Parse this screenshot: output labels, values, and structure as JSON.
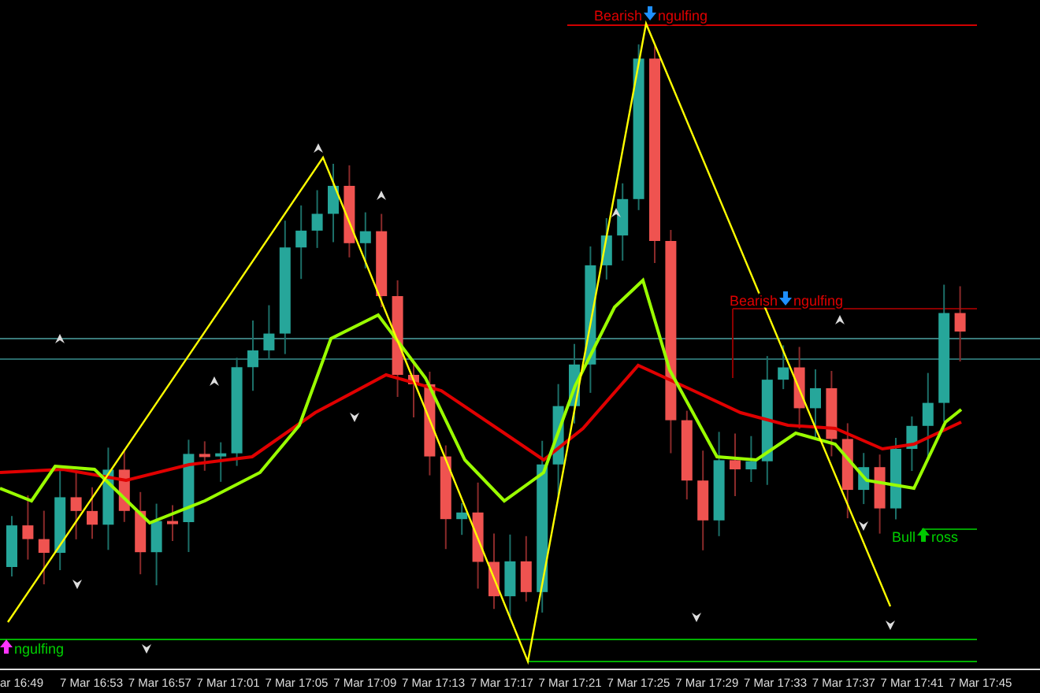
{
  "chart": {
    "time_labels": [
      "ar 16:49",
      "7 Mar 16:53",
      "7 Mar 16:57",
      "7 Mar 17:01",
      "7 Mar 17:05",
      "7 Mar 17:09",
      "7 Mar 17:13",
      "7 Mar 17:17",
      "7 Mar 17:21",
      "7 Mar 17:25",
      "7 Mar 17:29",
      "7 Mar 17:33",
      "7 Mar 17:37",
      "7 Mar 17:41",
      "7 Mar 17:45"
    ]
  },
  "signals": [
    {
      "kind": "bearish",
      "color": "#1e90ff",
      "before": "Bearish",
      "after": "ngulfing"
    },
    {
      "kind": "bearish",
      "color": "#1e90ff",
      "before": "Bearish",
      "after": "ngulfing"
    },
    {
      "kind": "bullish",
      "color": "#00c800",
      "before": "Bull",
      "after": "ross"
    },
    {
      "kind": "bullish",
      "color": "#ff33ff",
      "after": "ngulfing"
    }
  ]
}
